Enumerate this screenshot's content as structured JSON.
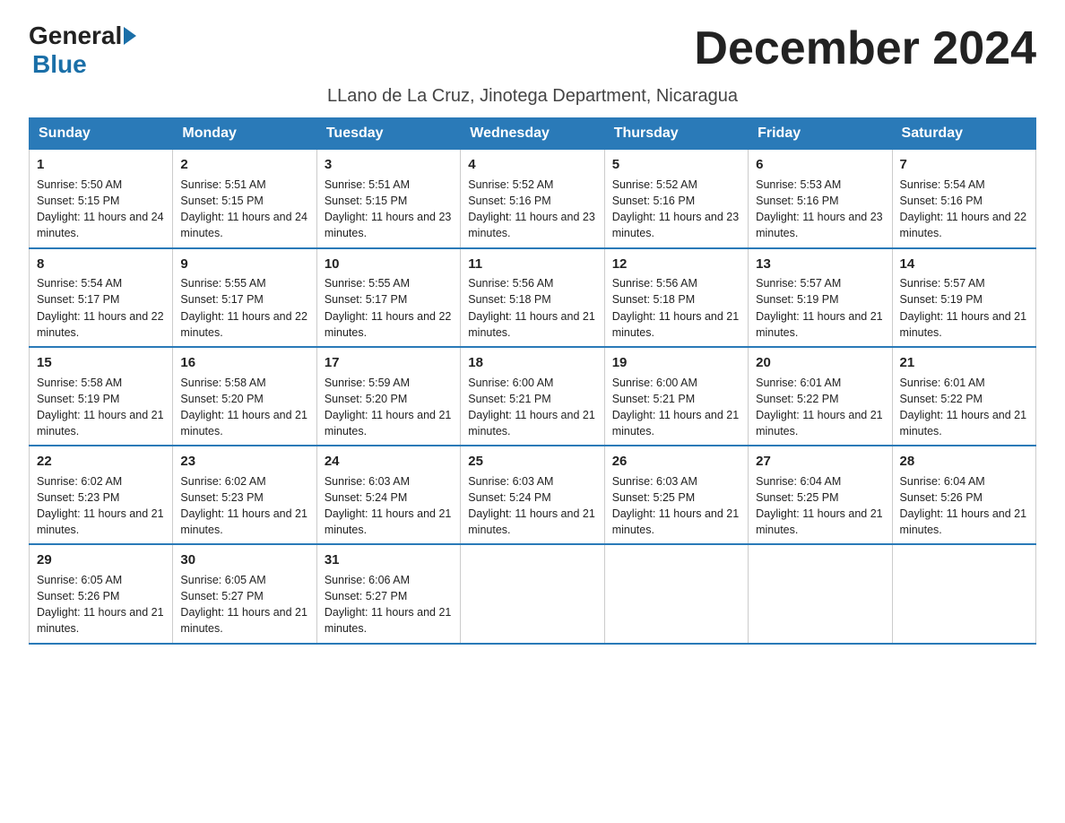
{
  "header": {
    "logo_general": "General",
    "logo_blue": "Blue",
    "month_title": "December 2024",
    "subtitle": "LLano de La Cruz, Jinotega Department, Nicaragua"
  },
  "days_of_week": [
    "Sunday",
    "Monday",
    "Tuesday",
    "Wednesday",
    "Thursday",
    "Friday",
    "Saturday"
  ],
  "weeks": [
    [
      {
        "day": "1",
        "sunrise": "5:50 AM",
        "sunset": "5:15 PM",
        "daylight": "11 hours and 24 minutes."
      },
      {
        "day": "2",
        "sunrise": "5:51 AM",
        "sunset": "5:15 PM",
        "daylight": "11 hours and 24 minutes."
      },
      {
        "day": "3",
        "sunrise": "5:51 AM",
        "sunset": "5:15 PM",
        "daylight": "11 hours and 23 minutes."
      },
      {
        "day": "4",
        "sunrise": "5:52 AM",
        "sunset": "5:16 PM",
        "daylight": "11 hours and 23 minutes."
      },
      {
        "day": "5",
        "sunrise": "5:52 AM",
        "sunset": "5:16 PM",
        "daylight": "11 hours and 23 minutes."
      },
      {
        "day": "6",
        "sunrise": "5:53 AM",
        "sunset": "5:16 PM",
        "daylight": "11 hours and 23 minutes."
      },
      {
        "day": "7",
        "sunrise": "5:54 AM",
        "sunset": "5:16 PM",
        "daylight": "11 hours and 22 minutes."
      }
    ],
    [
      {
        "day": "8",
        "sunrise": "5:54 AM",
        "sunset": "5:17 PM",
        "daylight": "11 hours and 22 minutes."
      },
      {
        "day": "9",
        "sunrise": "5:55 AM",
        "sunset": "5:17 PM",
        "daylight": "11 hours and 22 minutes."
      },
      {
        "day": "10",
        "sunrise": "5:55 AM",
        "sunset": "5:17 PM",
        "daylight": "11 hours and 22 minutes."
      },
      {
        "day": "11",
        "sunrise": "5:56 AM",
        "sunset": "5:18 PM",
        "daylight": "11 hours and 21 minutes."
      },
      {
        "day": "12",
        "sunrise": "5:56 AM",
        "sunset": "5:18 PM",
        "daylight": "11 hours and 21 minutes."
      },
      {
        "day": "13",
        "sunrise": "5:57 AM",
        "sunset": "5:19 PM",
        "daylight": "11 hours and 21 minutes."
      },
      {
        "day": "14",
        "sunrise": "5:57 AM",
        "sunset": "5:19 PM",
        "daylight": "11 hours and 21 minutes."
      }
    ],
    [
      {
        "day": "15",
        "sunrise": "5:58 AM",
        "sunset": "5:19 PM",
        "daylight": "11 hours and 21 minutes."
      },
      {
        "day": "16",
        "sunrise": "5:58 AM",
        "sunset": "5:20 PM",
        "daylight": "11 hours and 21 minutes."
      },
      {
        "day": "17",
        "sunrise": "5:59 AM",
        "sunset": "5:20 PM",
        "daylight": "11 hours and 21 minutes."
      },
      {
        "day": "18",
        "sunrise": "6:00 AM",
        "sunset": "5:21 PM",
        "daylight": "11 hours and 21 minutes."
      },
      {
        "day": "19",
        "sunrise": "6:00 AM",
        "sunset": "5:21 PM",
        "daylight": "11 hours and 21 minutes."
      },
      {
        "day": "20",
        "sunrise": "6:01 AM",
        "sunset": "5:22 PM",
        "daylight": "11 hours and 21 minutes."
      },
      {
        "day": "21",
        "sunrise": "6:01 AM",
        "sunset": "5:22 PM",
        "daylight": "11 hours and 21 minutes."
      }
    ],
    [
      {
        "day": "22",
        "sunrise": "6:02 AM",
        "sunset": "5:23 PM",
        "daylight": "11 hours and 21 minutes."
      },
      {
        "day": "23",
        "sunrise": "6:02 AM",
        "sunset": "5:23 PM",
        "daylight": "11 hours and 21 minutes."
      },
      {
        "day": "24",
        "sunrise": "6:03 AM",
        "sunset": "5:24 PM",
        "daylight": "11 hours and 21 minutes."
      },
      {
        "day": "25",
        "sunrise": "6:03 AM",
        "sunset": "5:24 PM",
        "daylight": "11 hours and 21 minutes."
      },
      {
        "day": "26",
        "sunrise": "6:03 AM",
        "sunset": "5:25 PM",
        "daylight": "11 hours and 21 minutes."
      },
      {
        "day": "27",
        "sunrise": "6:04 AM",
        "sunset": "5:25 PM",
        "daylight": "11 hours and 21 minutes."
      },
      {
        "day": "28",
        "sunrise": "6:04 AM",
        "sunset": "5:26 PM",
        "daylight": "11 hours and 21 minutes."
      }
    ],
    [
      {
        "day": "29",
        "sunrise": "6:05 AM",
        "sunset": "5:26 PM",
        "daylight": "11 hours and 21 minutes."
      },
      {
        "day": "30",
        "sunrise": "6:05 AM",
        "sunset": "5:27 PM",
        "daylight": "11 hours and 21 minutes."
      },
      {
        "day": "31",
        "sunrise": "6:06 AM",
        "sunset": "5:27 PM",
        "daylight": "11 hours and 21 minutes."
      },
      null,
      null,
      null,
      null
    ]
  ]
}
